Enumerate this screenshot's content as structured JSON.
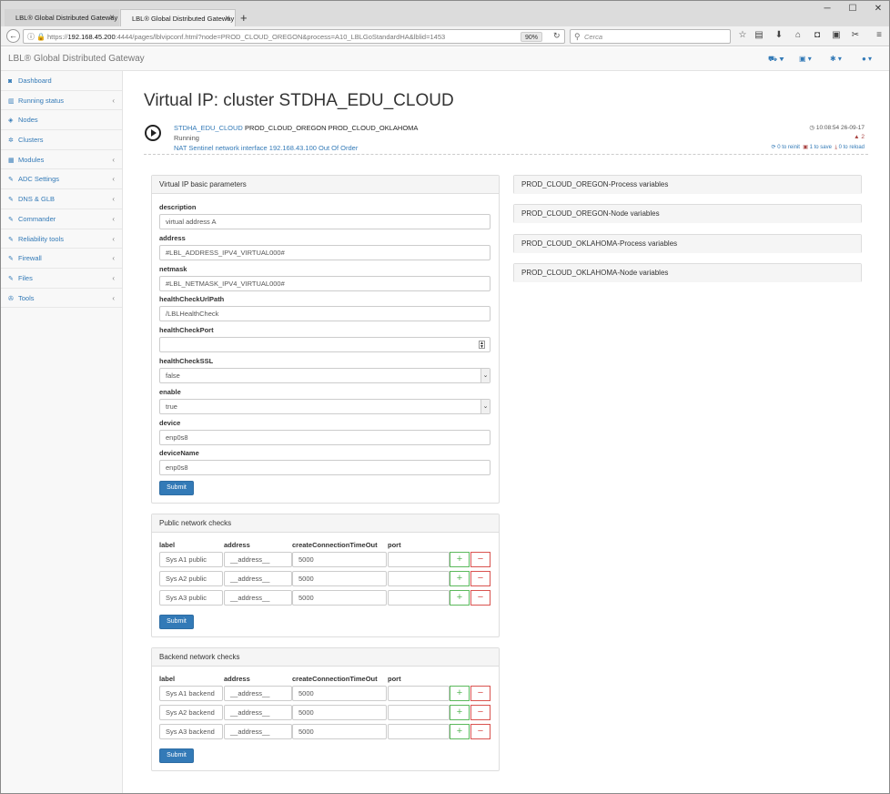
{
  "browser": {
    "tabs": [
      {
        "label": "LBL® Global Distributed Gateway"
      },
      {
        "label": "LBL® Global Distributed Gateway"
      }
    ],
    "new_tab": "+",
    "url_prefix": "https://",
    "url_host": "192.168.45.200",
    "url_rest": ":4444/pages/lblvipconf.html?node=PROD_CLOUD_OREGON&process=A10_LBLGoStandardHA&lblid=1453",
    "zoom": "90%",
    "search_placeholder": "Cerca"
  },
  "app": {
    "brand": "LBL® Global Distributed Gateway"
  },
  "sidebar": {
    "items": [
      {
        "label": "Dashboard",
        "icon": "dashboard-icon",
        "glyph": "◙",
        "chevron": ""
      },
      {
        "label": "Running status",
        "icon": "bar-chart-icon",
        "glyph": "▥",
        "chevron": "‹"
      },
      {
        "label": "Nodes",
        "icon": "cube-icon",
        "glyph": "◈",
        "chevron": ""
      },
      {
        "label": "Clusters",
        "icon": "cogs-icon",
        "glyph": "✲",
        "chevron": ""
      },
      {
        "label": "Modules",
        "icon": "cubes-icon",
        "glyph": "▦",
        "chevron": "‹"
      },
      {
        "label": "ADC Settings",
        "icon": "edit-icon",
        "glyph": "✎",
        "chevron": "‹"
      },
      {
        "label": "DNS & GLB",
        "icon": "edit-icon",
        "glyph": "✎",
        "chevron": "‹"
      },
      {
        "label": "Commander",
        "icon": "edit-icon",
        "glyph": "✎",
        "chevron": "‹"
      },
      {
        "label": "Reliability tools",
        "icon": "edit-icon",
        "glyph": "✎",
        "chevron": "‹"
      },
      {
        "label": "Firewall",
        "icon": "edit-icon",
        "glyph": "✎",
        "chevron": "‹"
      },
      {
        "label": "Files",
        "icon": "edit-icon",
        "glyph": "✎",
        "chevron": "‹"
      },
      {
        "label": "Tools",
        "icon": "wrench-icon",
        "glyph": "✇",
        "chevron": "‹"
      }
    ]
  },
  "page": {
    "title": "Virtual IP: cluster STDHA_EDU_CLOUD",
    "summary": {
      "cluster_link": "STDHA_EDU_CLOUD",
      "nodes": "PROD_CLOUD_OREGON PROD_CLOUD_OKLAHOMA",
      "status": "Running",
      "interface_info": "NAT Sentinel network interface 192.168.43.100 Out Of Order",
      "time": "10:08:54 26-09-17",
      "warnings": "2",
      "to_reinit": "0 to reinit",
      "to_save": "1 to save",
      "to_reload": "0 to reload"
    }
  },
  "basic_params": {
    "title": "Virtual IP basic parameters",
    "fields": [
      {
        "label": "description",
        "value": "virtual address A",
        "type": "text"
      },
      {
        "label": "address",
        "value": "#LBL_ADDRESS_IPV4_VIRTUAL000#",
        "type": "text"
      },
      {
        "label": "netmask",
        "value": "#LBL_NETMASK_IPV4_VIRTUAL000#",
        "type": "text"
      },
      {
        "label": "healthCheckUrlPath",
        "value": "/LBLHealthCheck",
        "type": "text"
      },
      {
        "label": "healthCheckPort",
        "value": "",
        "type": "number"
      },
      {
        "label": "healthCheckSSL",
        "value": "false",
        "type": "select"
      },
      {
        "label": "enable",
        "value": "true",
        "type": "select"
      },
      {
        "label": "device",
        "value": "enp0s8",
        "type": "text"
      },
      {
        "label": "deviceName",
        "value": "enp0s8",
        "type": "text"
      }
    ],
    "submit": "Submit"
  },
  "public_checks": {
    "title": "Public network checks",
    "headers": [
      "label",
      "address",
      "createConnectionTimeOut",
      "port"
    ],
    "rows": [
      {
        "label": "Sys A1 public",
        "address": "__address__",
        "timeout": "5000",
        "port": ""
      },
      {
        "label": "Sys A2 public",
        "address": "__address__",
        "timeout": "5000",
        "port": ""
      },
      {
        "label": "Sys A3 public",
        "address": "__address__",
        "timeout": "5000",
        "port": ""
      }
    ],
    "submit": "Submit"
  },
  "backend_checks": {
    "title": "Backend network checks",
    "headers": [
      "label",
      "address",
      "createConnectionTimeOut",
      "port"
    ],
    "rows": [
      {
        "label": "Sys A1 backend",
        "address": "__address__",
        "timeout": "5000",
        "port": ""
      },
      {
        "label": "Sys A2 backend",
        "address": "__address__",
        "timeout": "5000",
        "port": ""
      },
      {
        "label": "Sys A3 backend",
        "address": "__address__",
        "timeout": "5000",
        "port": ""
      }
    ],
    "submit": "Submit"
  },
  "variable_panels": [
    {
      "title": "PROD_CLOUD_OREGON-Process variables"
    },
    {
      "title": "PROD_CLOUD_OREGON-Node variables"
    },
    {
      "title": "PROD_CLOUD_OKLAHOMA-Process variables"
    },
    {
      "title": "PROD_CLOUD_OKLAHOMA-Node variables"
    }
  ],
  "row_buttons": {
    "add": "+",
    "remove": "−"
  }
}
